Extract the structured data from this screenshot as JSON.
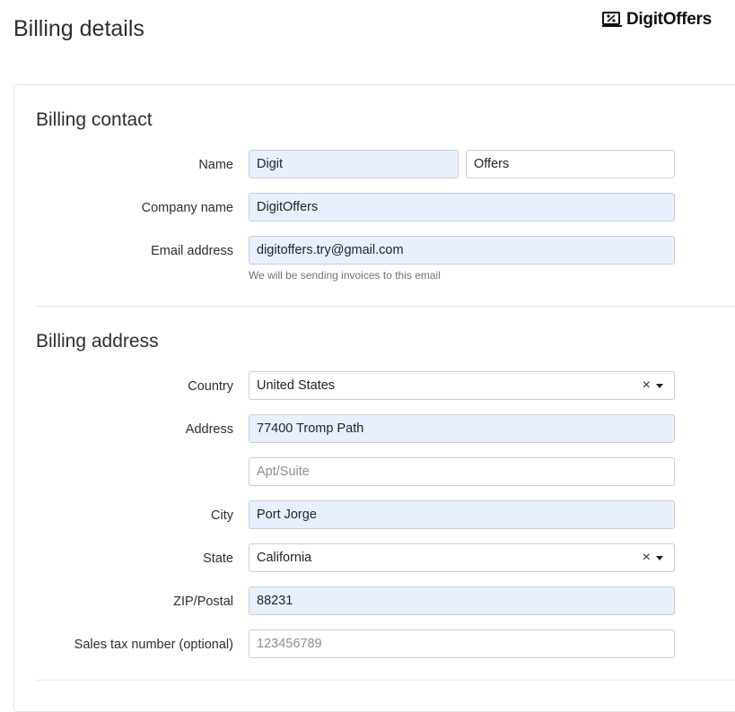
{
  "page": {
    "title": "Billing details"
  },
  "brand": {
    "name": "DigitOffers"
  },
  "billing_contact": {
    "title": "Billing contact",
    "name_label": "Name",
    "first_name": "Digit",
    "last_name": "Offers",
    "company_label": "Company name",
    "company": "DigitOffers",
    "email_label": "Email address",
    "email": "digitoffers.try@gmail.com",
    "email_hint": "We will be sending invoices to this email"
  },
  "billing_address": {
    "title": "Billing address",
    "country_label": "Country",
    "country": "United States",
    "address_label": "Address",
    "address": "77400 Tromp Path",
    "apt_placeholder": "Apt/Suite",
    "city_label": "City",
    "city": "Port Jorge",
    "state_label": "State",
    "state": "California",
    "zip_label": "ZIP/Postal",
    "zip": "88231",
    "tax_label": "Sales tax number (optional)",
    "tax_placeholder": "123456789"
  },
  "icons": {
    "clear": "×",
    "brand_icon": "percent-tag-icon"
  }
}
